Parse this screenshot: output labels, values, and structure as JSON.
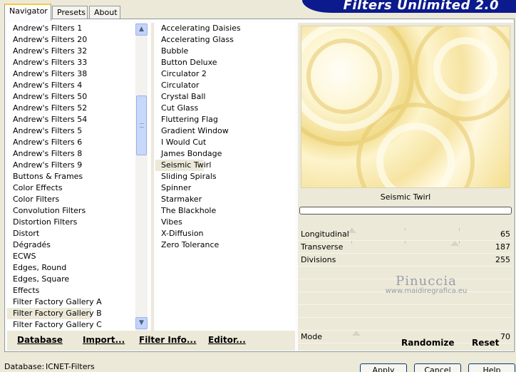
{
  "tabs": [
    "Navigator",
    "Presets",
    "About"
  ],
  "app_title": "Filters Unlimited 2.0",
  "categories": [
    "Andrew's Filters 1",
    "Andrew's Filters 20",
    "Andrew's Filters 32",
    "Andrew's Filters 33",
    "Andrew's Filters 38",
    "Andrew's Filters 4",
    "Andrew's Filters 50",
    "Andrew's Filters 52",
    "Andrew's Filters 54",
    "Andrew's Filters 5",
    "Andrew's Filters 6",
    "Andrew's Filters 8",
    "Andrew's Filters 9",
    "Buttons & Frames",
    "Color Effects",
    "Color Filters",
    "Convolution Filters",
    "Distortion Filters",
    "Distort",
    "Dégradés",
    "ECWS",
    "Edges, Round",
    "Edges, Square",
    "Effects",
    "Filter Factory Gallery A",
    "Filter Factory Gallery B",
    "Filter Factory Gallery C"
  ],
  "selected_category": "Filter Factory Gallery B",
  "filters": [
    "Accelerating Daisies",
    "Accelerating Glass",
    "Bubble",
    "Button Deluxe",
    "Circulator 2",
    "Circulator",
    "Crystal Ball",
    "Cut Glass",
    "Fluttering Flag",
    "Gradient Window",
    "I Would Cut",
    "James Bondage",
    "Seismic Twirl",
    "Sliding Spirals",
    "Spinner",
    "Starmaker",
    "The Blackhole",
    "Vibes",
    "X-Diffusion",
    "Zero Tolerance"
  ],
  "selected_filter": "Seismic Twirl",
  "bottom_buttons": {
    "database": "Database",
    "import": "Import...",
    "filter_info": "Filter Info...",
    "editor": "Editor..."
  },
  "preview_label": "Seismic Twirl",
  "params": [
    {
      "name": "Longitudinal",
      "value": "65"
    },
    {
      "name": "Transverse",
      "value": "187"
    },
    {
      "name": "Divisions",
      "value": "255"
    }
  ],
  "mode_param": {
    "name": "Mode",
    "value": "70"
  },
  "watermark": {
    "title": "Pinuccia",
    "url": "www.maidiregrafica.eu"
  },
  "randomize_label": "Randomize",
  "reset_label": "Reset",
  "status": {
    "label": "Database:",
    "value": "ICNET-Filters"
  },
  "dialog_buttons": {
    "apply": "Apply",
    "cancel": "Cancel",
    "help": "Help"
  },
  "colors": {
    "accent_banner": "#0b1a8c",
    "tab_highlight": "#ffc83c",
    "panel_bg": "#ece9d8"
  }
}
